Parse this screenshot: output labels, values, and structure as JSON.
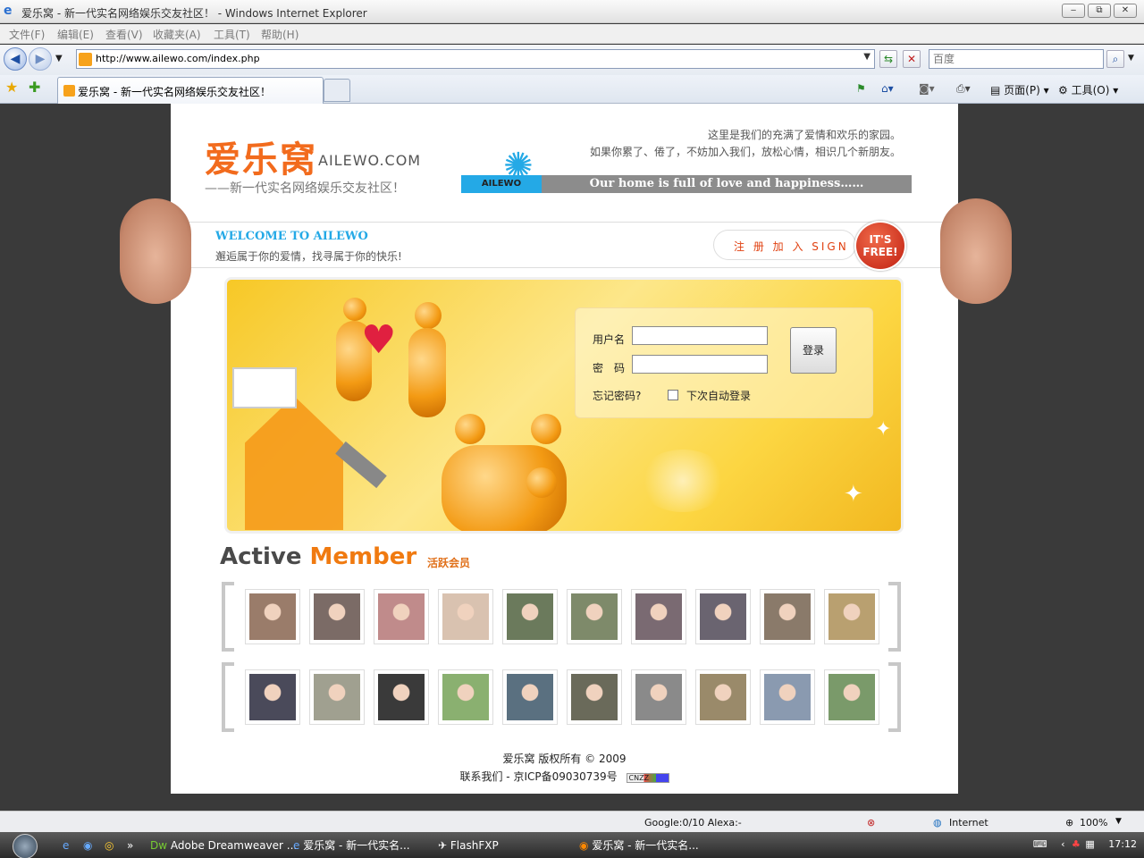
{
  "window": {
    "title": "爱乐窝 - 新一代实名网络娱乐交友社区！ - Windows Internet Explorer",
    "buttons": [
      "‒",
      "⧉",
      "✕"
    ]
  },
  "menu": [
    "文件(F)",
    "编辑(E)",
    "查看(V)",
    "收藏夹(A)",
    "工具(T)",
    "帮助(H)"
  ],
  "address": {
    "url": "http://www.ailewo.com/index.php",
    "search_placeholder": "百度"
  },
  "tab": {
    "label": "爱乐窝 - 新一代实名网络娱乐交友社区！"
  },
  "commandbar": {
    "page": "页面(P)",
    "tools": "工具(O)"
  },
  "site": {
    "logo_cn": "爱乐窝",
    "logo_en": "AILEWO.COM",
    "slogan": "——新一代实名网络娱乐交友社区！",
    "intro_line1": "这里是我们的充满了爱情和欢乐的家园。",
    "intro_line2": "如果你累了、倦了，不妨加入我们，放松心情，相识几个新朋友。",
    "banner_tag": "AILEWO",
    "banner_text": "Our home is full of love and happiness……",
    "welcome_title": "WELCOME TO AILEWO",
    "welcome_sub": "邂逅属于你的爱情，找寻属于你的快乐!",
    "signup": "注 册 加 入  SIGN UP",
    "free_badge": "IT'S FREE!"
  },
  "login": {
    "username_label": "用户名",
    "password_label": "密　码",
    "forgot": "忘记密码?",
    "remember": "下次自动登录",
    "submit": "登录"
  },
  "members": {
    "title_a": "Active",
    "title_b": "Member",
    "title_cn": "活跃会员",
    "row1_colors": [
      "#9a7c6a",
      "#7b6b66",
      "#c08b8b",
      "#d9c2b0",
      "#6b7a5c",
      "#7e8a6a",
      "#7a6a72",
      "#6a6470",
      "#8a7a6a",
      "#b9a070"
    ],
    "row2_colors": [
      "#4a4a5a",
      "#a0a090",
      "#3a3a3a",
      "#8ab070",
      "#5a7080",
      "#6a6a5a",
      "#8a8a8a",
      "#9a8a6a",
      "#8a9ab0",
      "#7a9a6a"
    ]
  },
  "footer": {
    "line1": "爱乐窝 版权所有 © 2009",
    "line2": "联系我们 - 京ICP备09030739号",
    "badge": "CNZZ"
  },
  "status": {
    "google": "Google:0/10  Alexa:-",
    "zone": "Internet",
    "zoom": "100%"
  },
  "taskbar": {
    "items": [
      "Adobe Dreamweaver ...",
      "爱乐窝 - 新一代实名...",
      "FlashFXP",
      "爱乐窝 - 新一代实名..."
    ],
    "time": "17:12"
  },
  "colors": {
    "accent": "#f26b1d",
    "blue": "#24a9e6",
    "hero": "#f7c826"
  }
}
